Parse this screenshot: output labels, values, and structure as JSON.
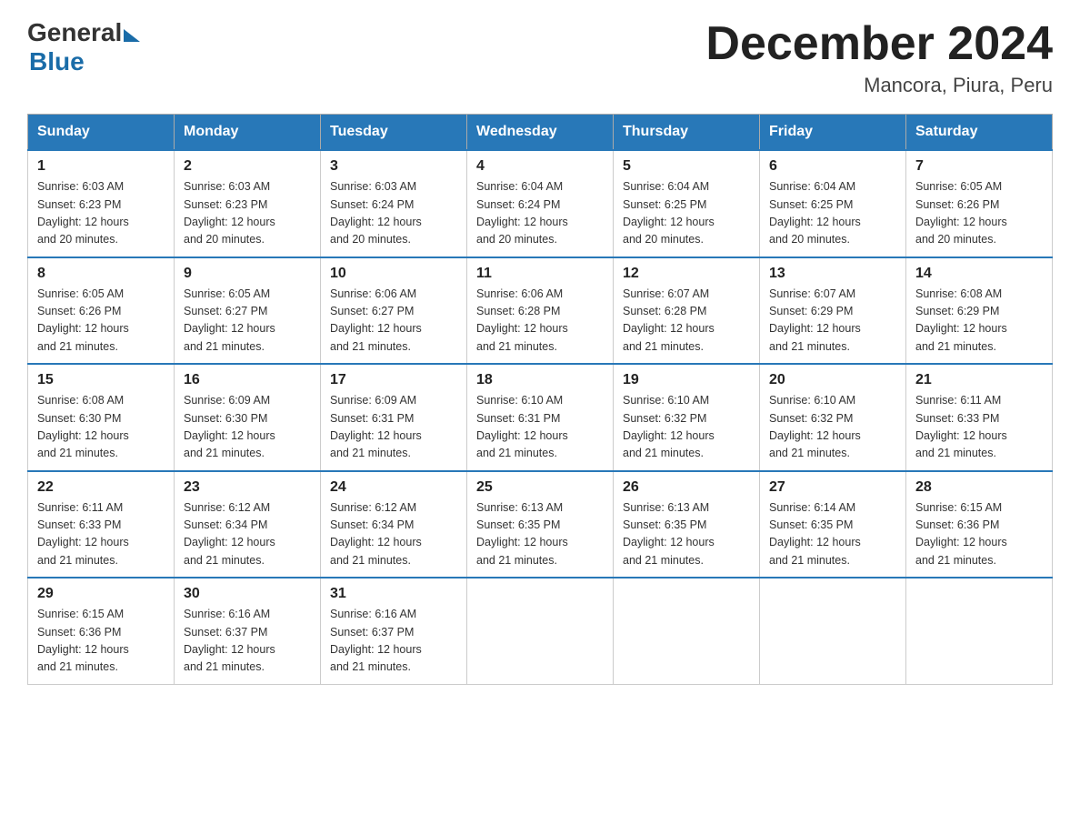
{
  "header": {
    "logo_general": "General",
    "logo_blue": "Blue",
    "title": "December 2024",
    "subtitle": "Mancora, Piura, Peru"
  },
  "days_of_week": [
    "Sunday",
    "Monday",
    "Tuesday",
    "Wednesday",
    "Thursday",
    "Friday",
    "Saturday"
  ],
  "weeks": [
    [
      {
        "day": "1",
        "sunrise": "6:03 AM",
        "sunset": "6:23 PM",
        "daylight": "12 hours and 20 minutes."
      },
      {
        "day": "2",
        "sunrise": "6:03 AM",
        "sunset": "6:23 PM",
        "daylight": "12 hours and 20 minutes."
      },
      {
        "day": "3",
        "sunrise": "6:03 AM",
        "sunset": "6:24 PM",
        "daylight": "12 hours and 20 minutes."
      },
      {
        "day": "4",
        "sunrise": "6:04 AM",
        "sunset": "6:24 PM",
        "daylight": "12 hours and 20 minutes."
      },
      {
        "day": "5",
        "sunrise": "6:04 AM",
        "sunset": "6:25 PM",
        "daylight": "12 hours and 20 minutes."
      },
      {
        "day": "6",
        "sunrise": "6:04 AM",
        "sunset": "6:25 PM",
        "daylight": "12 hours and 20 minutes."
      },
      {
        "day": "7",
        "sunrise": "6:05 AM",
        "sunset": "6:26 PM",
        "daylight": "12 hours and 20 minutes."
      }
    ],
    [
      {
        "day": "8",
        "sunrise": "6:05 AM",
        "sunset": "6:26 PM",
        "daylight": "12 hours and 21 minutes."
      },
      {
        "day": "9",
        "sunrise": "6:05 AM",
        "sunset": "6:27 PM",
        "daylight": "12 hours and 21 minutes."
      },
      {
        "day": "10",
        "sunrise": "6:06 AM",
        "sunset": "6:27 PM",
        "daylight": "12 hours and 21 minutes."
      },
      {
        "day": "11",
        "sunrise": "6:06 AM",
        "sunset": "6:28 PM",
        "daylight": "12 hours and 21 minutes."
      },
      {
        "day": "12",
        "sunrise": "6:07 AM",
        "sunset": "6:28 PM",
        "daylight": "12 hours and 21 minutes."
      },
      {
        "day": "13",
        "sunrise": "6:07 AM",
        "sunset": "6:29 PM",
        "daylight": "12 hours and 21 minutes."
      },
      {
        "day": "14",
        "sunrise": "6:08 AM",
        "sunset": "6:29 PM",
        "daylight": "12 hours and 21 minutes."
      }
    ],
    [
      {
        "day": "15",
        "sunrise": "6:08 AM",
        "sunset": "6:30 PM",
        "daylight": "12 hours and 21 minutes."
      },
      {
        "day": "16",
        "sunrise": "6:09 AM",
        "sunset": "6:30 PM",
        "daylight": "12 hours and 21 minutes."
      },
      {
        "day": "17",
        "sunrise": "6:09 AM",
        "sunset": "6:31 PM",
        "daylight": "12 hours and 21 minutes."
      },
      {
        "day": "18",
        "sunrise": "6:10 AM",
        "sunset": "6:31 PM",
        "daylight": "12 hours and 21 minutes."
      },
      {
        "day": "19",
        "sunrise": "6:10 AM",
        "sunset": "6:32 PM",
        "daylight": "12 hours and 21 minutes."
      },
      {
        "day": "20",
        "sunrise": "6:10 AM",
        "sunset": "6:32 PM",
        "daylight": "12 hours and 21 minutes."
      },
      {
        "day": "21",
        "sunrise": "6:11 AM",
        "sunset": "6:33 PM",
        "daylight": "12 hours and 21 minutes."
      }
    ],
    [
      {
        "day": "22",
        "sunrise": "6:11 AM",
        "sunset": "6:33 PM",
        "daylight": "12 hours and 21 minutes."
      },
      {
        "day": "23",
        "sunrise": "6:12 AM",
        "sunset": "6:34 PM",
        "daylight": "12 hours and 21 minutes."
      },
      {
        "day": "24",
        "sunrise": "6:12 AM",
        "sunset": "6:34 PM",
        "daylight": "12 hours and 21 minutes."
      },
      {
        "day": "25",
        "sunrise": "6:13 AM",
        "sunset": "6:35 PM",
        "daylight": "12 hours and 21 minutes."
      },
      {
        "day": "26",
        "sunrise": "6:13 AM",
        "sunset": "6:35 PM",
        "daylight": "12 hours and 21 minutes."
      },
      {
        "day": "27",
        "sunrise": "6:14 AM",
        "sunset": "6:35 PM",
        "daylight": "12 hours and 21 minutes."
      },
      {
        "day": "28",
        "sunrise": "6:15 AM",
        "sunset": "6:36 PM",
        "daylight": "12 hours and 21 minutes."
      }
    ],
    [
      {
        "day": "29",
        "sunrise": "6:15 AM",
        "sunset": "6:36 PM",
        "daylight": "12 hours and 21 minutes."
      },
      {
        "day": "30",
        "sunrise": "6:16 AM",
        "sunset": "6:37 PM",
        "daylight": "12 hours and 21 minutes."
      },
      {
        "day": "31",
        "sunrise": "6:16 AM",
        "sunset": "6:37 PM",
        "daylight": "12 hours and 21 minutes."
      },
      null,
      null,
      null,
      null
    ]
  ],
  "labels": {
    "sunrise": "Sunrise:",
    "sunset": "Sunset:",
    "daylight": "Daylight:"
  }
}
